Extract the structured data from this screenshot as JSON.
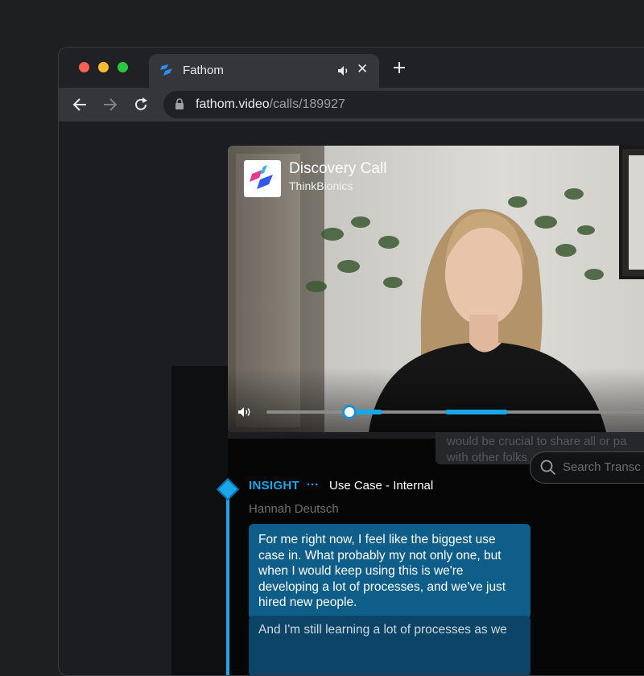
{
  "browser": {
    "tab_title": "Fathom",
    "new_tab_icon": "plus-icon",
    "url_host": "fathom.video",
    "url_path": "/calls/189927"
  },
  "video": {
    "title": "Discovery Call",
    "subtitle": "ThinkBionics",
    "progress_fraction": 0.2
  },
  "transcript": {
    "prev_line1": "would be crucial to share all or pa",
    "prev_line2": "with other folks",
    "search_placeholder": "Search Transc",
    "insight": {
      "label": "INSIGHT",
      "dots": "···",
      "topic": "Use Case - Internal",
      "speaker": "Hannah Deutsch",
      "text": "For me right now, I feel like the biggest use case in. What probably my not only one, but when I would keep using this is we're developing a lot of processes, and we've just hired new people.",
      "next_text": "And I'm still learning a lot of processes as we"
    }
  },
  "colors": {
    "accent": "#18a7e8",
    "bubble": "#0f5e8a"
  }
}
